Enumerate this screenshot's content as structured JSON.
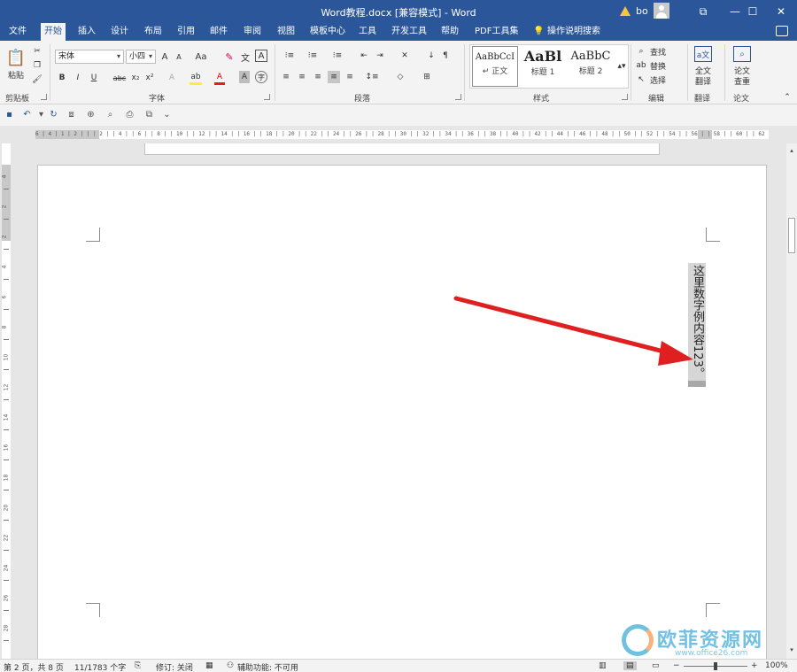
{
  "window": {
    "title": "Word教程.docx [兼容模式]  -  Word",
    "user": "bo",
    "controls": {
      "restore": "⧉",
      "minimize": "—",
      "maximize": "☐",
      "close": "✕"
    }
  },
  "menu": {
    "tabs": [
      "文件",
      "开始",
      "插入",
      "设计",
      "布局",
      "引用",
      "邮件",
      "审阅",
      "视图",
      "模板中心",
      "工具",
      "开发工具",
      "帮助",
      "PDF工具集"
    ],
    "active_tab": "开始",
    "search_label": "操作说明搜索"
  },
  "ribbon": {
    "clipboard": {
      "paste": "粘贴",
      "label": "剪贴板"
    },
    "font": {
      "name": "宋体",
      "size": "小四",
      "label": "字体",
      "bold": "B",
      "italic": "I",
      "underline": "U",
      "strike": "abc",
      "sub": "x₂",
      "sup": "x²",
      "grow": "A",
      "shrink": "A",
      "case": "Aa",
      "color": "A"
    },
    "paragraph": {
      "label": "段落"
    },
    "styles": {
      "label": "样式",
      "items": [
        {
          "sample": "AaBbCcI",
          "name": "↵ 正文"
        },
        {
          "sample": "AaBl",
          "name": "标题 1"
        },
        {
          "sample": "AaBbC",
          "name": "标题 2"
        }
      ]
    },
    "editing": {
      "find": "查找",
      "replace": "替换",
      "select": "选择",
      "label": "编辑"
    },
    "translate": {
      "full": "全文",
      "full2": "翻译",
      "label": "翻译"
    },
    "paper": {
      "check": "论文",
      "check2": "查重",
      "label": "论文"
    }
  },
  "ruler_text": "6 | 4 | 1 | 2 |  |  | 2 |  | 4 |  | 6 |  | 8 |  | 10 |  | 12 |  | 14 |  | 16 |  | 18 |  | 20 |  | 22 |  | 24 |  | 26 |  | 28 |  | 30 |  | 32 |  | 34 |  | 36 |  | 38 |  | 40 |  | 42 |  | 44 |  | 46 |  | 48 |  | 50 |  | 52 |  | 54 |  | 56 |  | 58 |  | 60 |  | 62 |  | 64",
  "vertical_ruler_numbers": [
    "4",
    "2",
    "2",
    "4",
    "6",
    "8",
    "10",
    "12",
    "14",
    "16",
    "18",
    "20",
    "22",
    "24",
    "26",
    "28"
  ],
  "document": {
    "textbox_text": "这里数字例内容123。"
  },
  "status": {
    "page": "第 2 页，共 8 页",
    "words": "11/1783 个字",
    "track": "修订: 关闭",
    "accessibility": "辅助功能: 不可用",
    "zoom": "100%",
    "zoom_level": 1.0
  },
  "watermark": {
    "text": "欧菲资源网",
    "url": "www.office26.com"
  },
  "colors": {
    "titlebar": "#2b579a",
    "arrow": "#e02020"
  }
}
